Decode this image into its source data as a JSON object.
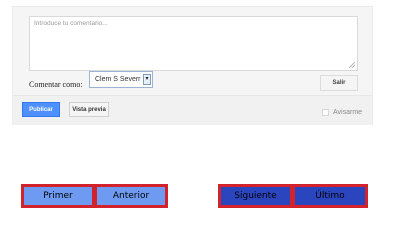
{
  "comment_form": {
    "placeholder": "Introduce tu comentario...",
    "comment_as_label": "Comentar como:",
    "identity_selected": "Clem S Severr",
    "signout_label": "Salir",
    "publish_label": "Publicar",
    "preview_label": "Vista previa",
    "notify_label": "Avisarme"
  },
  "pager": {
    "first": "Primer",
    "previous": "Anterior",
    "next": "Siguiente",
    "last": "Último"
  },
  "colors": {
    "publish_blue": "#4d90fe",
    "pager_light_blue": "#6e9bf1",
    "pager_dark_blue": "#2b45bf",
    "pager_border_red": "#d2222b"
  }
}
